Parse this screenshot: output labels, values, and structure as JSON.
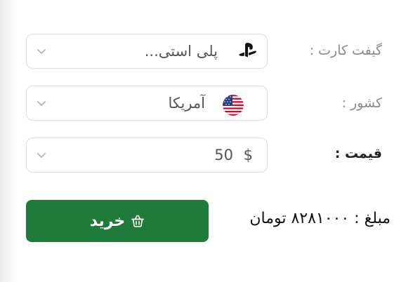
{
  "giftcard": {
    "label": "گیفت کارت :",
    "value": "پلی استی...",
    "icon": "playstation-icon"
  },
  "country": {
    "label": "کشور :",
    "value": "آمریکا",
    "icon": "us-flag-icon"
  },
  "price": {
    "label": "قیمت :",
    "value": "50",
    "currency_symbol": "$"
  },
  "buy_button": {
    "label": "خرید",
    "icon": "basket-icon",
    "color": "#1e7b3a"
  },
  "amount": {
    "text": "مبلغ : ۸۲۸۱۰۰۰ تومان"
  }
}
